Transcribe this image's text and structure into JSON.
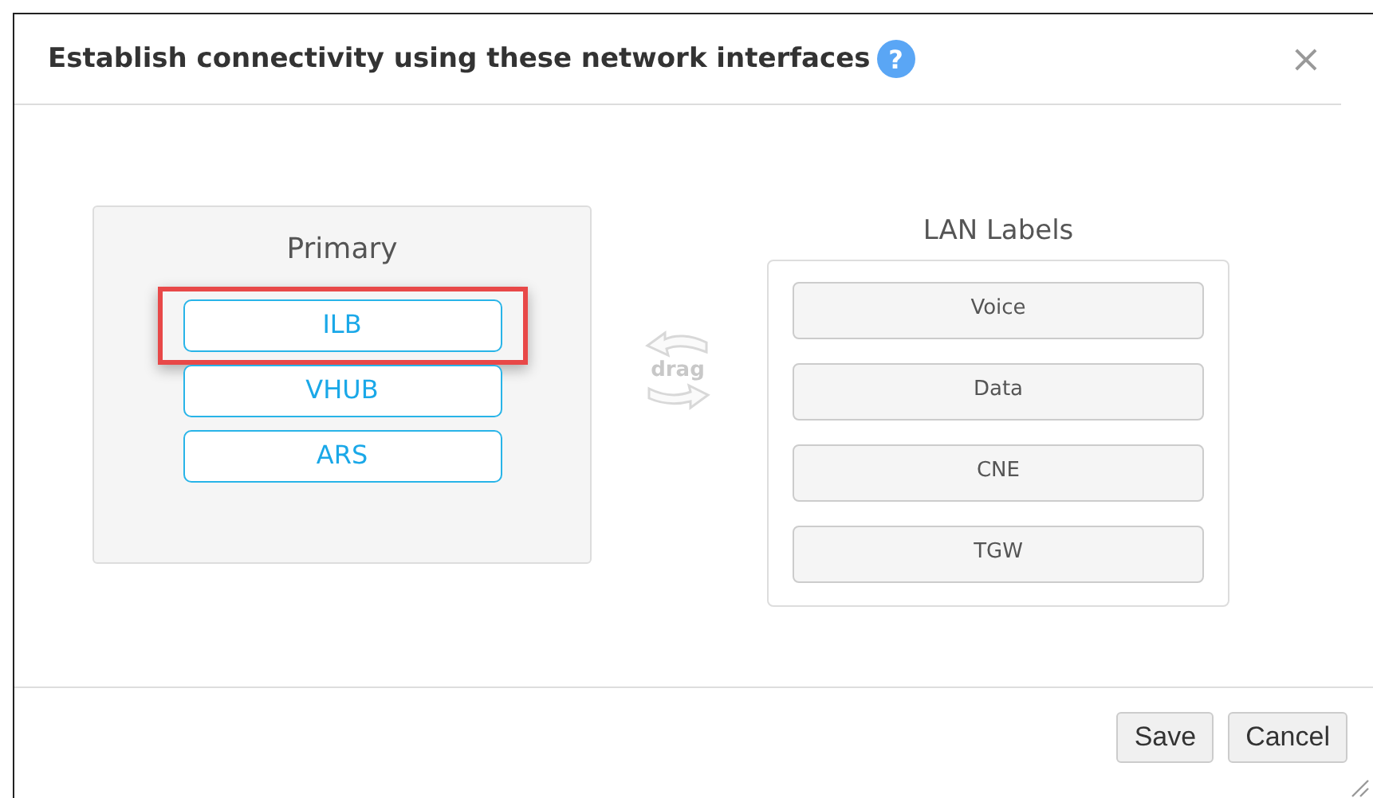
{
  "dialog": {
    "title": "Establish connectivity using these network interfaces",
    "help": "?",
    "close": "×"
  },
  "primary": {
    "title": "Primary",
    "items": [
      {
        "label": "ILB",
        "highlighted": true
      },
      {
        "label": "VHUB",
        "highlighted": false
      },
      {
        "label": "ARS",
        "highlighted": false
      }
    ]
  },
  "drag_hint": "drag",
  "lan_labels": {
    "title": "LAN Labels",
    "items": [
      "Voice",
      "Data",
      "CNE",
      "TGW"
    ]
  },
  "buttons": [
    "Save",
    "Cancel"
  ]
}
